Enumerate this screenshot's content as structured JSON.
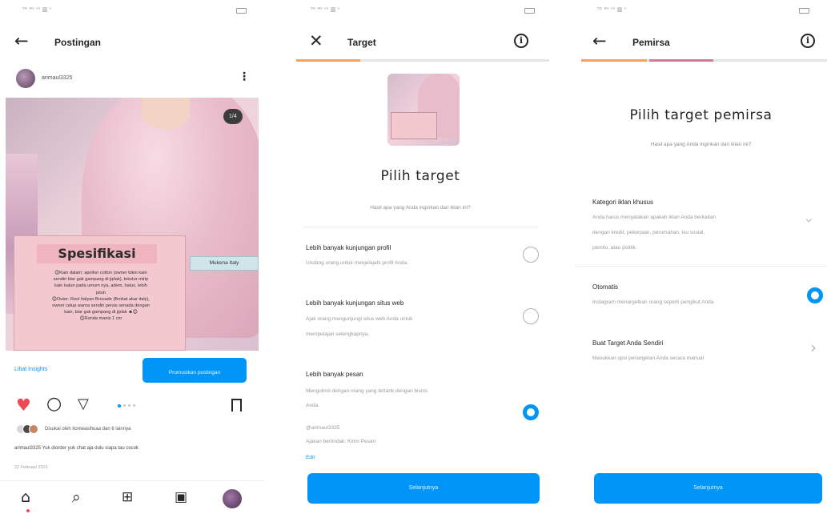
{
  "panel1": {
    "status_bar": {
      "signal": "⁵ᴳ ⁴ᴳ ⁿⁿ ▥ ⁿ",
      "battery_icon": "battery-icon"
    },
    "header": {
      "back_icon": "←",
      "title": "Postingan"
    },
    "post": {
      "username": "arimaul3325",
      "more_icon": "⋮",
      "image_counter": "1/4",
      "spec_title": "Spesifikasi",
      "spec_lines": [
        "🛈Kain dalam: apollon cotton (owner bikin kain",
        "sendiri biar gak gampang di jiplak), tekstur mirip",
        "kain katun pada umum nya, adem, halus, lebih",
        "jatuh",
        "🛈Outer: Rool Italyan Brocade (Brokat akar italy),",
        "owner celup warna sendiri persis senada dengan",
        "kain, biar gak gampang di jiplak ☻🛈",
        "🛈Renda manis 1 cm"
      ],
      "side_label": "Mukena Italy",
      "insights_link": "Lihat Insights",
      "promote_button": "Promosikan postingan",
      "likes_text": "Disukai oleh itomeasihuaa dan 6 lainnya",
      "caption_user": "arimaul3325",
      "caption_text": "Yuk diorder yuk chat aja dulu siapa tau cocok",
      "date": "22 Februari 2021"
    },
    "actions": {
      "heart": "♥",
      "comment": "○",
      "share": "▽",
      "save": "⊓"
    },
    "nav": {
      "home": "⌂",
      "search": "⌕",
      "add": "⊞",
      "reels": "▣"
    }
  },
  "panel2": {
    "status_bar": {
      "signal": "⁵ᴳ ⁴ᴳ ⁿⁿ ▥ ⁿ"
    },
    "header": {
      "close_icon": "✕",
      "title": "Target",
      "info_icon": "i"
    },
    "heading": "Pilih target",
    "subheading": "Hasil apa yang Anda inginkan dari iklan ini?",
    "options": [
      {
        "title": "Lebih banyak kunjungan profil",
        "desc": [
          "Undang orang untuk menjelajahi profil Anda."
        ],
        "selected": false
      },
      {
        "title": "Lebih banyak kunjungan situs web",
        "desc": [
          "Ajak orang mengunjungi situs web Anda untuk",
          "mempelajari selengkapnya."
        ],
        "selected": false
      },
      {
        "title": "Lebih banyak pesan",
        "desc": [
          "Mengobrol dengan orang yang tertarik dengan bisnis",
          "Anda."
        ],
        "selected": true
      }
    ],
    "message_detail": {
      "account": "@arimaul3325",
      "action": "Ajakan bertindak: Kirim Pesan",
      "edit": "Edit"
    },
    "next_button": "Selanjutnya"
  },
  "panel3": {
    "status_bar": {
      "signal": "⁵ᴳ ⁴ᴳ ⁿⁿ ▥ ⁿ"
    },
    "header": {
      "back_icon": "←",
      "title": "Pemirsa",
      "info_icon": "i"
    },
    "heading": "Pilih target pemirsa",
    "subheading": "Hasil apa yang Anda inginkan dari iklan ini?",
    "special_category": {
      "title": "Kategori iklan khusus",
      "desc": [
        "Anda harus menyatakan apakah iklan Anda berkaitan",
        "dengan kredit, pekerjaan, perumahan, isu sosial,",
        "pemilu, atau politik."
      ]
    },
    "options": [
      {
        "title": "Otomatis",
        "desc": "Instagram menargetkan orang seperti pengikut Anda",
        "selected": true
      },
      {
        "title": "Buat Target Anda Sendiri",
        "desc": "Masukkan opsi penargetan Anda secara manual"
      }
    ],
    "next_button": "Selanjutnya"
  },
  "colors": {
    "accent": "#0095f6",
    "heart": "#ed4956",
    "progress_orange": "#f5a25d",
    "progress_pink": "#d9779b"
  }
}
